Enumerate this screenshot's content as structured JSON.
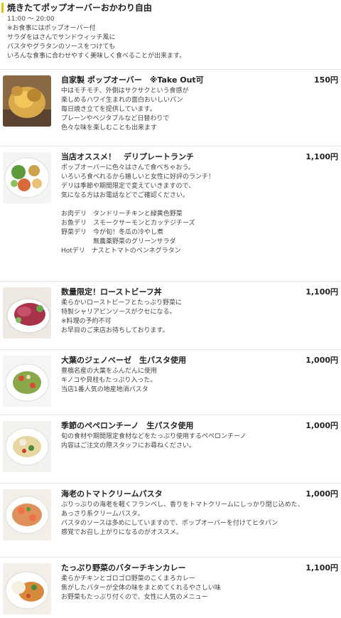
{
  "header": {
    "title": "焼きたてポップオーバーおかわり自由",
    "hours": "11:00 〜 20:00",
    "lines": [
      "※お食事にはポップオーバー付",
      "サラダをはさんでサンドウィッチ風に",
      "パスタやグラタンのソースをつけても",
      "いろんな食事に合わせやすく美味しく食べることが出来ます。"
    ]
  },
  "menu": [
    {
      "name": "自家製 ポップオーバー　※Take Out可",
      "price": "150円",
      "desc": [
        "中はモチモチ、外側はサクサクという食感が",
        "楽しめるハワイ生まれの面白おいしいパン",
        "毎日焼き立てを提供しています。",
        "プレーンやベジタブルなど日替わりで",
        "色々な味を楽しむことも出来ます"
      ]
    },
    {
      "name": "当店オススメ！　デリプレートランチ",
      "price": "1,100円",
      "desc": [
        "ポップオーバーに色々はさんで食べちゃおう。",
        "いろいろ食べれるから嬉しいと女性に好評のランチ！",
        "デリは季節や期間限定で変えていきますので、",
        "気になる方はお電話などでご確認ください。",
        "",
        "お肉デリ　タンドリーチキンと緑黄色野菜",
        "お魚デリ　スモークサーモンとカッテジチーズ",
        "野菜デリ　今が旬！冬瓜の冷やし煮",
        "　　　　　無農薬野菜のグリーンサラダ",
        "Hotデリ　ナスとトマトのペンネグラタン"
      ]
    },
    {
      "name": "数量限定！ローストビーフ丼",
      "price": "1,100円",
      "desc": [
        "柔らかいローストビーフとたっぷり野菜に",
        "特製シャリアピンソースがクセになる。",
        "※料理の予約不可",
        "お早目のご来店お待ちしております。"
      ]
    },
    {
      "name": "大葉のジェノベーゼ　生パスタ使用",
      "price": "1,000円",
      "desc": [
        "豊橋名産の大葉をふんだんに使用",
        "キノコや貝柱もたっぷり入った。",
        "当店1番人気の地産地消パスタ"
      ]
    },
    {
      "name": "季節のペペロンチーノ　生パスタ使用",
      "price": "1,000円",
      "desc": [
        "旬の食材や期間限定食材などをたっぷり使用するペペロンチーノ",
        "内容はご注文の際スタッフにお尋ねください。"
      ]
    },
    {
      "name": "海老のトマトクリームパスタ",
      "price": "1,000円",
      "desc": [
        "ぷりっぷりの海老を軽くフランベし、香りをトマトクリームにしっかり閉じ込めた、",
        "あっさり系クリームパスタ。",
        "パスタのソースは多めにしていますので、ポップオーバーを付けてヒタパン",
        "感覚でお召し上がりになるのがオススメ。"
      ]
    },
    {
      "name": "たっぷり野菜のバターチキンカレー",
      "price": "1,100円",
      "desc": [
        "柔らかチキンとゴロゴロ野菜のこくまろカレー",
        "焦がしたバターが全体の味をまとめてくれるやさしい味",
        "お野菜もたっぷり付くので、女性に人気のメニュー"
      ]
    }
  ]
}
